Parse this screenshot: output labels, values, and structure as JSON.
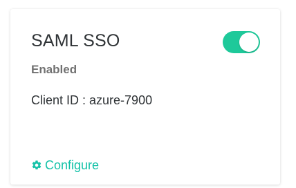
{
  "card": {
    "title": "SAML SSO",
    "toggle_on": true,
    "status": "Enabled",
    "client_id_text": "Client ID : azure-7900",
    "configure_label": "Configure",
    "configure_icon": "gear-icon"
  },
  "colors": {
    "accent": "#1ec99a",
    "link": "#14c2a8",
    "title_text": "#2f3336",
    "status_text": "#717171"
  }
}
